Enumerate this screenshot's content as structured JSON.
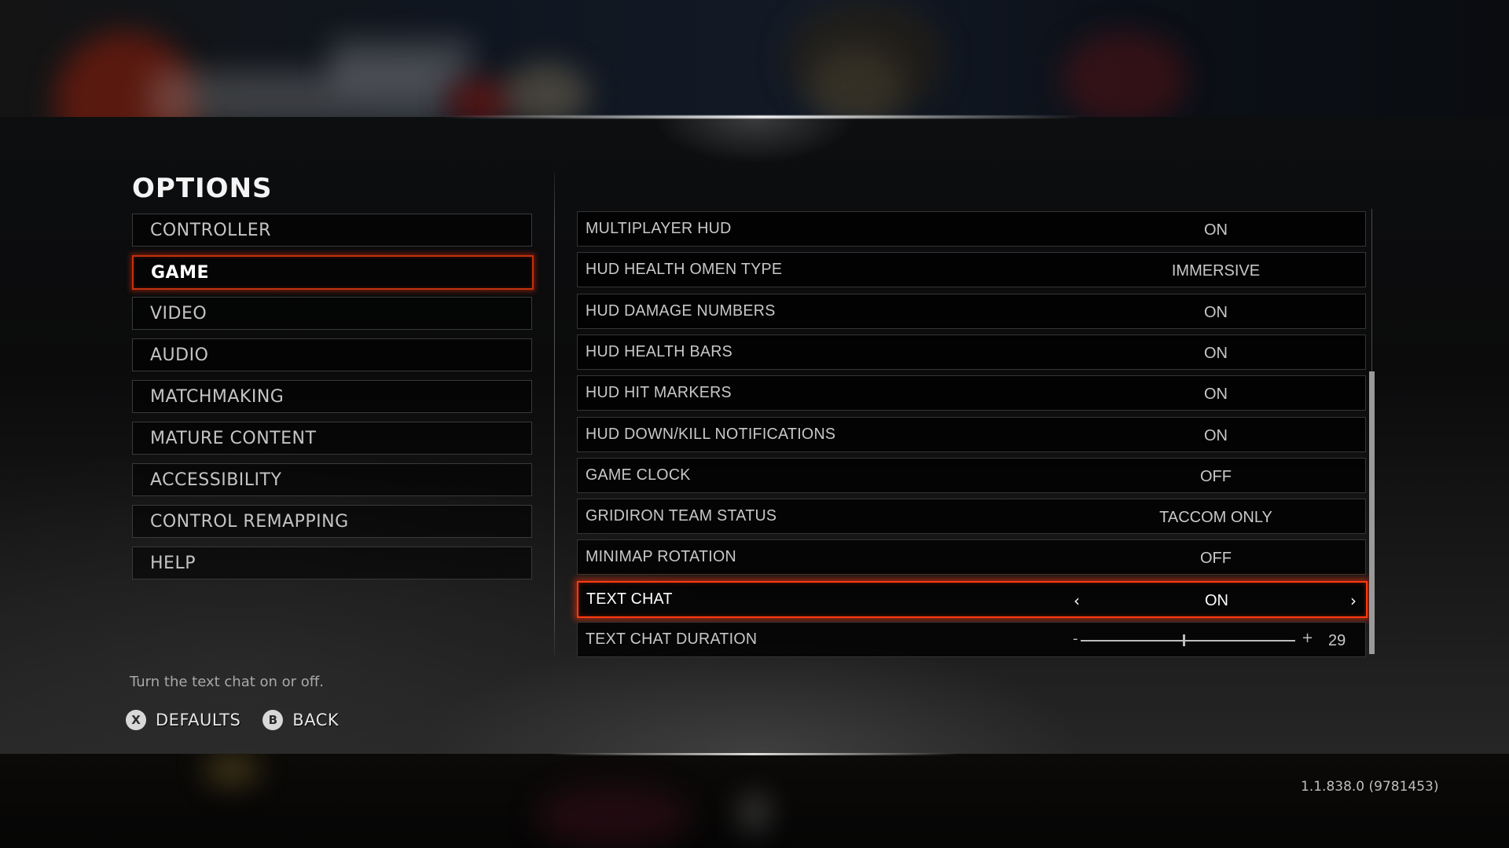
{
  "header": {
    "title": "OPTIONS"
  },
  "sidebar": {
    "selected_index": 1,
    "items": [
      {
        "label": "CONTROLLER"
      },
      {
        "label": "GAME"
      },
      {
        "label": "VIDEO"
      },
      {
        "label": "AUDIO"
      },
      {
        "label": "MATCHMAKING"
      },
      {
        "label": "MATURE CONTENT"
      },
      {
        "label": "ACCESSIBILITY"
      },
      {
        "label": "CONTROL REMAPPING"
      },
      {
        "label": "HELP"
      }
    ]
  },
  "settings": {
    "selected_index": 9,
    "rows": [
      {
        "label": "MULTIPLAYER HUD",
        "value": "ON"
      },
      {
        "label": "HUD HEALTH OMEN TYPE",
        "value": "IMMERSIVE"
      },
      {
        "label": "HUD DAMAGE NUMBERS",
        "value": "ON"
      },
      {
        "label": "HUD HEALTH BARS",
        "value": "ON"
      },
      {
        "label": "HUD HIT MARKERS",
        "value": "ON"
      },
      {
        "label": "HUD DOWN/KILL NOTIFICATIONS",
        "value": "ON"
      },
      {
        "label": "GAME CLOCK",
        "value": "OFF"
      },
      {
        "label": "GRIDIRON TEAM STATUS",
        "value": "TACCOM ONLY"
      },
      {
        "label": "MINIMAP ROTATION",
        "value": "OFF"
      },
      {
        "label": "TEXT CHAT",
        "value": "ON",
        "prev_glyph": "‹",
        "next_glyph": "›"
      },
      {
        "label": "TEXT CHAT DURATION",
        "value": "29",
        "slider_fraction": 0.48,
        "minus_glyph": "-",
        "plus_glyph": "+"
      }
    ],
    "scroll": {
      "thumb_start_fraction": 0.365,
      "thumb_end_fraction": 1.0
    }
  },
  "footer": {
    "description": "Turn the text chat on or off.",
    "buttons": [
      {
        "glyph": "X",
        "label": "DEFAULTS",
        "icon": "x-button-icon"
      },
      {
        "glyph": "B",
        "label": "BACK",
        "icon": "b-button-icon"
      }
    ],
    "version": "1.1.838.0 (9781453)"
  },
  "colors": {
    "accent": "#ff3a10",
    "text": "#c8c8c8",
    "selected_text": "#ffffff"
  }
}
